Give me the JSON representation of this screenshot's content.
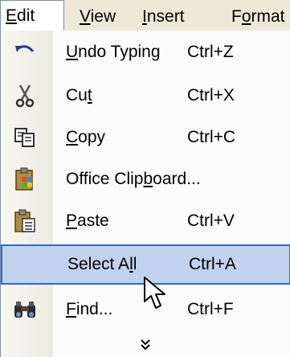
{
  "menubar": {
    "items": [
      {
        "label": "Edit",
        "ul": "E",
        "rest": "dit"
      },
      {
        "label": "View",
        "ul": "V",
        "rest": "iew"
      },
      {
        "label": "Insert",
        "ul": "I",
        "rest": "nsert"
      },
      {
        "label": "Format",
        "pre": "F",
        "ul": "o",
        "rest": "rmat"
      }
    ]
  },
  "menu": {
    "items": [
      {
        "pre": "",
        "ul": "U",
        "rest": "ndo Typing",
        "shortcut": "Ctrl+Z",
        "icon": "undo-icon"
      },
      {
        "pre": "Cu",
        "ul": "t",
        "rest": "",
        "shortcut": "Ctrl+X",
        "icon": "scissors-icon"
      },
      {
        "pre": "",
        "ul": "C",
        "rest": "opy",
        "shortcut": "Ctrl+C",
        "icon": "copy-icon"
      },
      {
        "pre": "Office Clip",
        "ul": "b",
        "rest": "oard...",
        "shortcut": "",
        "icon": "office-clipboard-icon"
      },
      {
        "pre": "",
        "ul": "P",
        "rest": "aste",
        "shortcut": "Ctrl+V",
        "icon": "paste-icon"
      },
      {
        "pre": "Select A",
        "ul": "l",
        "rest": "l",
        "shortcut": "Ctrl+A",
        "icon": ""
      },
      {
        "pre": "",
        "ul": "F",
        "rest": "ind...",
        "shortcut": "Ctrl+F",
        "icon": "binoculars-icon"
      }
    ],
    "more_glyph": "»",
    "selected_index": 5
  }
}
